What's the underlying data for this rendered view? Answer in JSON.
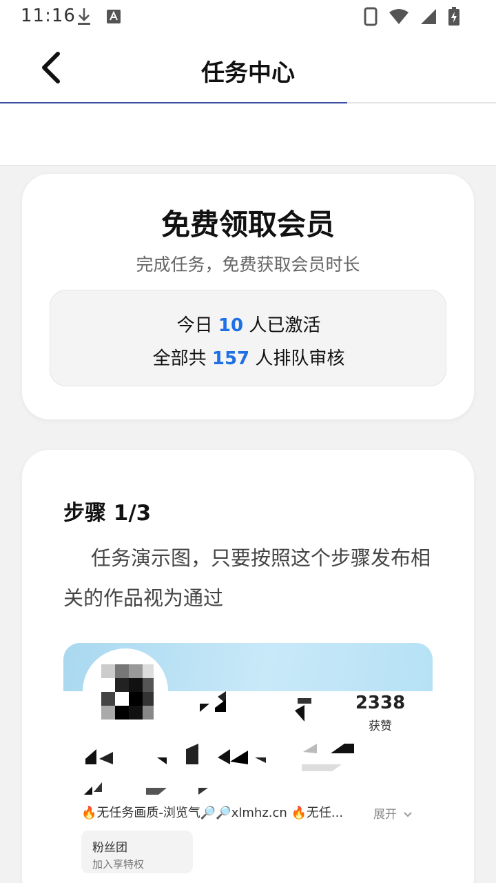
{
  "status_bar": {
    "time": "11:16",
    "icons": [
      "download-icon",
      "keyboard-indicator-icon",
      "phone-icon",
      "wifi-icon",
      "signal-icon",
      "battery-charging-icon"
    ]
  },
  "app_bar": {
    "back_icon": "chevron-left-icon",
    "title": "任务中心",
    "accent_color": "#3a4fa0"
  },
  "progress": {
    "completed_fraction": 0.7
  },
  "promo_card": {
    "title": "免费领取会员",
    "subtitle": "完成任务，免费获取会员时长",
    "stats": {
      "today_prefix": "今日",
      "today_count": "10",
      "today_suffix": "人已激活",
      "total_prefix": "全部共",
      "total_count": "157",
      "total_suffix": "人排队审核"
    },
    "highlight_color": "#1f6fe5"
  },
  "step_card": {
    "title": "步骤 1/3",
    "description": "任务演示图，只要按照这个步骤发布相关的作品视为通过",
    "demo": {
      "likes_count": "2338",
      "likes_label": "获赞",
      "bio": "🔥无任务画质-浏览气🔎🔎xlmhz.cn 🔥无任...",
      "expand_label": "展开",
      "fan_group_title": "粉丝团",
      "fan_group_sub": "加入享特权"
    }
  }
}
